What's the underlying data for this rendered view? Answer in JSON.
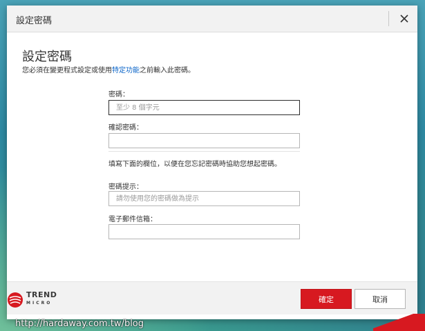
{
  "dialog": {
    "title": "設定密碼",
    "heading": "設定密碼",
    "subtext_before": "您必須在變更程式設定或使用",
    "subtext_link": "特定功能",
    "subtext_after": "之前輸入此密碼。",
    "close_icon": "close-icon"
  },
  "form": {
    "password_label": "密碼：",
    "password_placeholder": "至少 8 個字元",
    "confirm_label": "確認密碼：",
    "note": "填寫下面的欄位，以便在您忘記密碼時協助您想起密碼。",
    "hint_label": "密碼提示：",
    "hint_placeholder": "請勿使用您的密碼做為提示",
    "email_label": "電子郵件信箱："
  },
  "footer": {
    "logo_word": "TREND",
    "logo_sub": "MICRO",
    "ok_label": "確定",
    "cancel_label": "取消"
  },
  "watermark": "http://hardaway.com.tw/blog",
  "colors": {
    "accent": "#d71920",
    "link": "#0a64c8"
  }
}
